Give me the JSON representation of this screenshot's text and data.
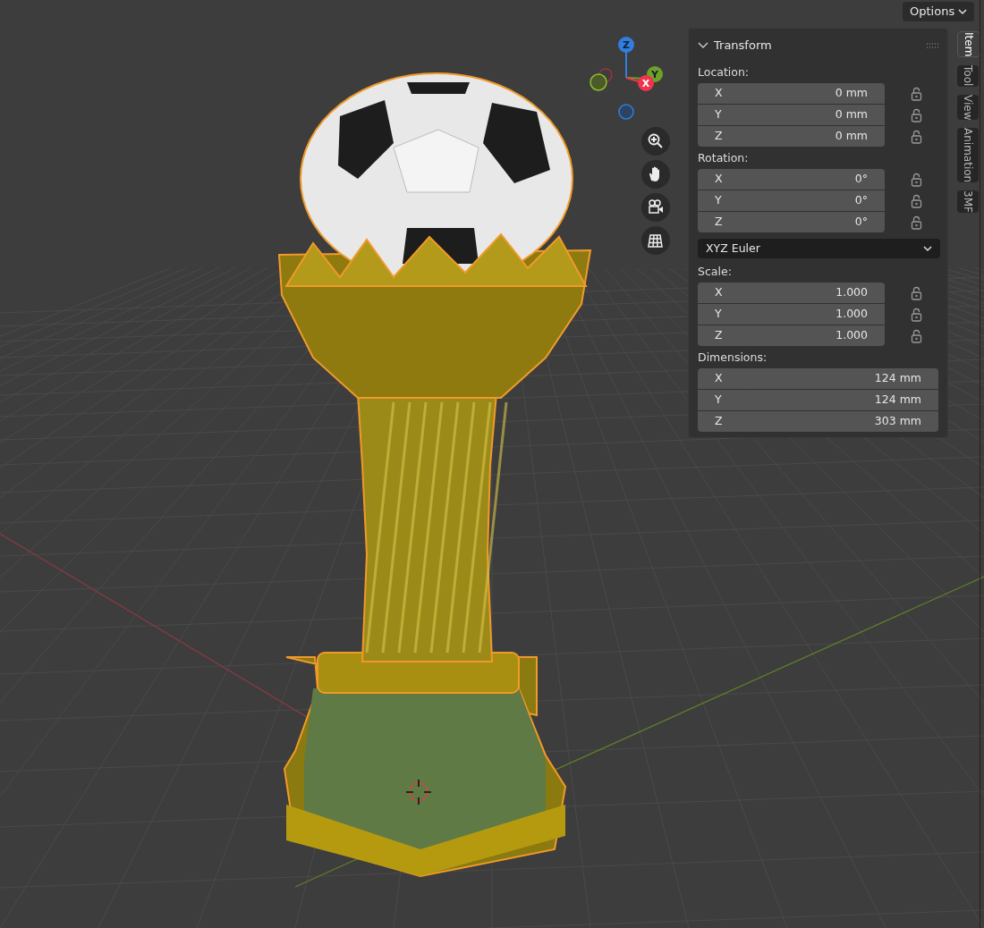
{
  "header": {
    "options_button": "Options"
  },
  "gizmo": {
    "axes": [
      {
        "label": "Z",
        "color": "#2f7ee0"
      },
      {
        "label": "Y",
        "color": "#6ea126"
      },
      {
        "label": "X",
        "color": "#f0344f"
      }
    ]
  },
  "panel": {
    "title": "Transform",
    "expanded": true,
    "sections": [
      {
        "kind": "vector",
        "label": "Location:",
        "fields": [
          {
            "axis": "X",
            "value": "0 mm",
            "locked": false
          },
          {
            "axis": "Y",
            "value": "0 mm",
            "locked": false
          },
          {
            "axis": "Z",
            "value": "0 mm",
            "locked": false
          }
        ]
      },
      {
        "kind": "vector",
        "label": "Rotation:",
        "fields": [
          {
            "axis": "X",
            "value": "0°",
            "locked": false
          },
          {
            "axis": "Y",
            "value": "0°",
            "locked": false
          },
          {
            "axis": "Z",
            "value": "0°",
            "locked": false
          }
        ]
      },
      {
        "kind": "dropdown",
        "value": "XYZ Euler"
      },
      {
        "kind": "vector",
        "label": "Scale:",
        "fields": [
          {
            "axis": "X",
            "value": "1.000",
            "locked": false
          },
          {
            "axis": "Y",
            "value": "1.000",
            "locked": false
          },
          {
            "axis": "Z",
            "value": "1.000",
            "locked": false
          }
        ]
      },
      {
        "kind": "vector",
        "label": "Dimensions:",
        "fields": [
          {
            "axis": "X",
            "value": "124 mm"
          },
          {
            "axis": "Y",
            "value": "124 mm"
          },
          {
            "axis": "Z",
            "value": "303 mm"
          }
        ]
      }
    ]
  },
  "tabs": [
    {
      "label": "Item",
      "selected": true
    },
    {
      "label": "Tool",
      "selected": false
    },
    {
      "label": "View",
      "selected": false
    },
    {
      "label": "Animation",
      "selected": false
    },
    {
      "label": "3MF",
      "selected": false
    }
  ]
}
